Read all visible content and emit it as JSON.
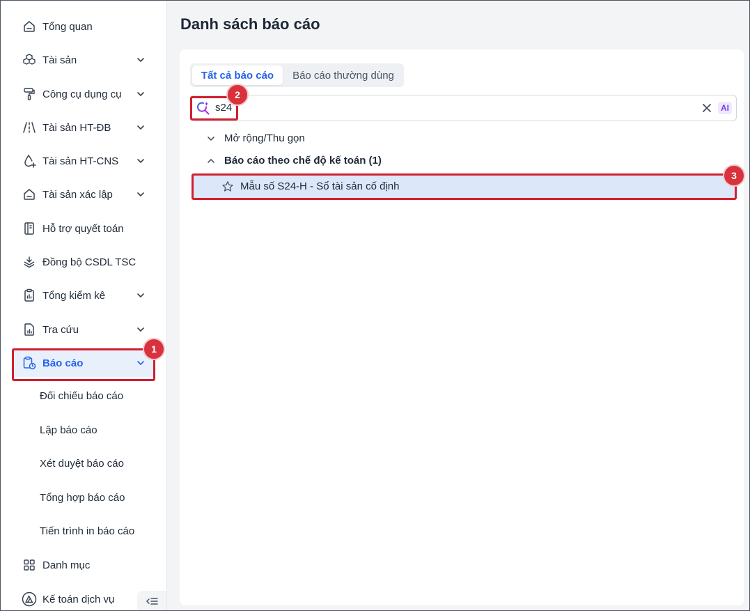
{
  "sidebar": {
    "items": [
      {
        "label": "Tổng quan",
        "icon": "home-icon",
        "expandable": false
      },
      {
        "label": "Tài sản",
        "icon": "boxes-icon",
        "expandable": true
      },
      {
        "label": "Công cụ dụng cụ",
        "icon": "paint-roller-icon",
        "expandable": true
      },
      {
        "label": "Tài sản HT-ĐB",
        "icon": "road-icon",
        "expandable": true
      },
      {
        "label": "Tài sản HT-CNS",
        "icon": "water-drop-icon",
        "expandable": true
      },
      {
        "label": "Tài sản xác lập",
        "icon": "home-icon",
        "expandable": true
      },
      {
        "label": "Hỗ trợ quyết toán",
        "icon": "notebook-icon",
        "expandable": false
      },
      {
        "label": "Đồng bộ CSDL TSC",
        "icon": "layers-icon",
        "expandable": false
      },
      {
        "label": "Tổng kiểm kê",
        "icon": "clipboard-icon",
        "expandable": true
      },
      {
        "label": "Tra cứu",
        "icon": "file-chart-icon",
        "expandable": true
      },
      {
        "label": "Báo cáo",
        "icon": "report-clock-icon",
        "expandable": true,
        "active": true
      },
      {
        "label": "Danh mục",
        "icon": "grid-icon",
        "expandable": false
      },
      {
        "label": "Kế toán dịch vụ",
        "icon": "triangle-logo-icon",
        "expandable": false
      }
    ],
    "report_subitems": [
      "Đối chiếu báo cáo",
      "Lập báo cáo",
      "Xét duyệt báo cáo",
      "Tổng hợp báo cáo",
      "Tiến trình in báo cáo"
    ]
  },
  "main": {
    "title": "Danh sách báo cáo",
    "tabs": [
      {
        "label": "Tất cả báo cáo",
        "active": true
      },
      {
        "label": "Báo cáo thường dùng",
        "active": false
      }
    ],
    "search": {
      "value": "s24",
      "ai_label": "AI"
    },
    "tree": {
      "expand_collapse_label": "Mở rộng/Thu gọn",
      "group_label": "Báo cáo theo chế độ kế toán (1)",
      "result_label": "Mẫu số S24-H - Sổ tài sản cố định"
    }
  },
  "annotations": [
    "1",
    "2",
    "3"
  ],
  "colors": {
    "accent": "#2563eb",
    "active_bg": "#e8f0fc",
    "highlight": "#d01f2f",
    "result_bg": "#dce8f9"
  }
}
